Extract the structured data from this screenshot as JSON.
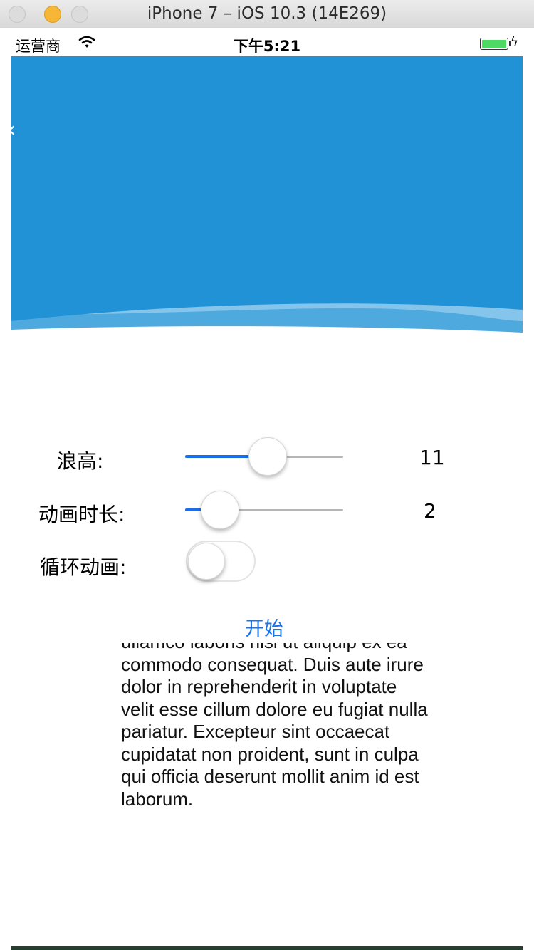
{
  "window": {
    "title": "iPhone 7 – iOS 10.3 (14E269)"
  },
  "status_bar": {
    "carrier": "运营商",
    "time": "下午5:21",
    "battery_fill": 1.0
  },
  "header": {
    "color_primary": "#2192d6",
    "color_secondary": "#85c5ec",
    "back_glyph": "‹"
  },
  "controls": {
    "wave_height": {
      "label": "浪高:",
      "value": 11,
      "value_text": "11",
      "fraction": 0.53
    },
    "duration": {
      "label": "动画时长:",
      "value": 2,
      "value_text": "2",
      "fraction": 0.13
    },
    "loop": {
      "label": "循环动画:",
      "on": false
    }
  },
  "start_button": {
    "label": "开始",
    "color": "#1a73e8"
  },
  "lorem_text": "ullamco laboris nisi ut aliquip ex ea commodo consequat. Duis aute irure dolor in reprehenderit in voluptate velit esse cillum dolore eu fugiat nulla pariatur. Excepteur sint occaecat cupidatat non proident, sunt in culpa qui officia deserunt mollit anim id est laborum."
}
